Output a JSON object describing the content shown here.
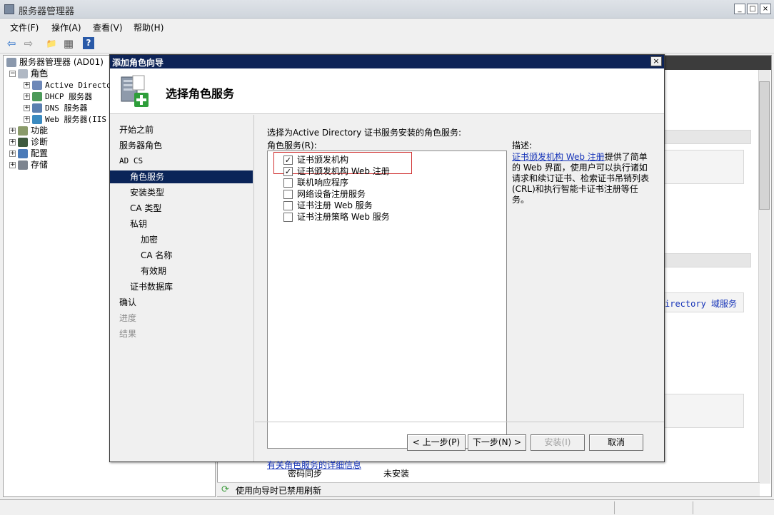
{
  "window": {
    "title": "服务器管理器",
    "btn_min": "_",
    "btn_max": "□",
    "btn_close": "×"
  },
  "menu": [
    "文件(F)",
    "操作(A)",
    "查看(V)",
    "帮助(H)"
  ],
  "toolbar": {
    "back": "⇦",
    "forward": "⇨",
    "up": "📁",
    "view": "▦",
    "help": "?"
  },
  "tree": {
    "root": "服务器管理器 (AD01)",
    "roles": "角色",
    "role_children": [
      "Active Directo",
      "DHCP 服务器",
      "DNS 服务器",
      "Web 服务器(IIS"
    ],
    "others": [
      "功能",
      "诊断",
      "配置",
      "存储"
    ]
  },
  "background": {
    "directory_text": "irectory 域服务",
    "row1_label": "密码同步",
    "row1_value": "未安装",
    "status": "使用向导时已禁用刷新"
  },
  "dialog": {
    "title": "添加角色向导",
    "close": "×",
    "heading": "选择角色服务",
    "nav": [
      {
        "label": "开始之前",
        "state": "normal",
        "indent": 0
      },
      {
        "label": "服务器角色",
        "state": "normal",
        "indent": 0
      },
      {
        "label": "AD CS",
        "state": "normal",
        "indent": 0
      },
      {
        "label": "角色服务",
        "state": "active",
        "indent": 1
      },
      {
        "label": "安装类型",
        "state": "normal",
        "indent": 1
      },
      {
        "label": "CA 类型",
        "state": "normal",
        "indent": 1
      },
      {
        "label": "私钥",
        "state": "normal",
        "indent": 1
      },
      {
        "label": "加密",
        "state": "normal",
        "indent": 2
      },
      {
        "label": "CA 名称",
        "state": "normal",
        "indent": 2
      },
      {
        "label": "有效期",
        "state": "normal",
        "indent": 2
      },
      {
        "label": "证书数据库",
        "state": "normal",
        "indent": 1
      },
      {
        "label": "确认",
        "state": "normal",
        "indent": 0
      },
      {
        "label": "进度",
        "state": "disabled",
        "indent": 0
      },
      {
        "label": "结果",
        "state": "disabled",
        "indent": 0
      }
    ],
    "prompt": "选择为Active Directory 证书服务安装的角色服务:",
    "role_services_label": "角色服务(R):",
    "services": [
      {
        "label": "证书颁发机构",
        "checked": true
      },
      {
        "label": "证书颁发机构 Web 注册",
        "checked": true
      },
      {
        "label": "联机响应程序",
        "checked": false
      },
      {
        "label": "网络设备注册服务",
        "checked": false
      },
      {
        "label": "证书注册 Web 服务",
        "checked": false
      },
      {
        "label": "证书注册策略 Web 服务",
        "checked": false
      }
    ],
    "desc_label": "描述:",
    "desc_link": "证书颁发机构 Web 注册",
    "desc_text": "提供了简单的 Web 界面，使用户可以执行诸如请求和续订证书、检索证书吊销列表(CRL)和执行智能卡证书注册等任务。",
    "more_info": "有关角色服务的详细信息",
    "buttons": {
      "prev": "< 上一步(P)",
      "next": "下一步(N) >",
      "install": "安装(I)",
      "cancel": "取消"
    }
  }
}
